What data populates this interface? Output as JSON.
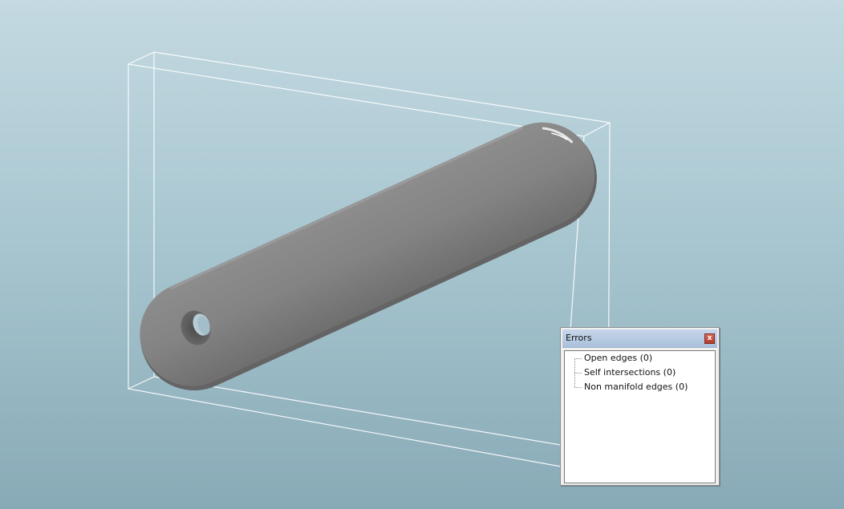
{
  "viewport": {
    "background_top": "#c4d9e1",
    "background_bottom": "#88aab6",
    "model_color": "#858585",
    "bounding_box_color": "#ffffff"
  },
  "errors_panel": {
    "title": "Errors",
    "close_label": "x",
    "items": [
      {
        "label": "Open edges (0)"
      },
      {
        "label": "Self intersections (0)"
      },
      {
        "label": "Non manifold edges (0)"
      }
    ]
  }
}
